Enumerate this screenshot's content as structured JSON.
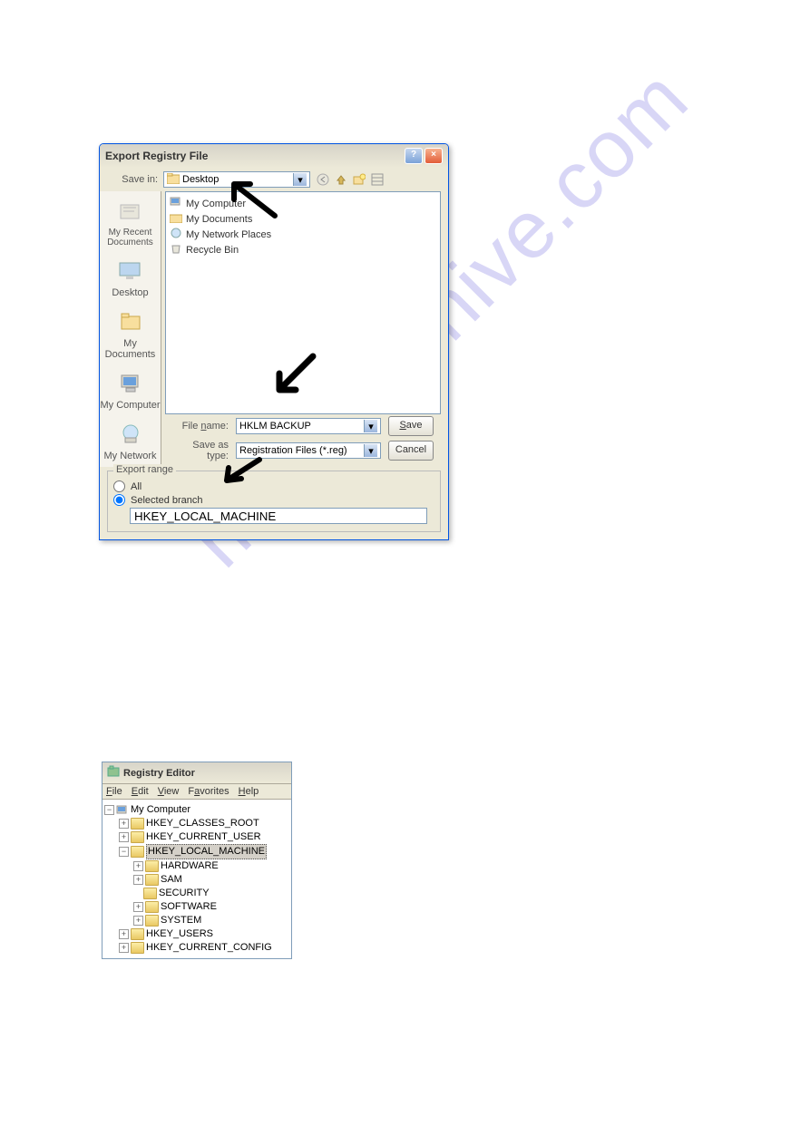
{
  "watermark": "manualshive.com",
  "export": {
    "title": "Export Registry File",
    "savein_label": "Save in:",
    "savein_value": "Desktop",
    "files": [
      "My Computer",
      "My Documents",
      "My Network Places",
      "Recycle Bin"
    ],
    "sidebar": [
      "My Recent Documents",
      "Desktop",
      "My Documents",
      "My Computer",
      "My Network"
    ],
    "filename_label": "File name:",
    "filename_value": "HKLM BACKUP",
    "saveas_label": "Save as type:",
    "saveas_value": "Registration Files (*.reg)",
    "save_btn": "Save",
    "cancel_btn": "Cancel",
    "range_title": "Export range",
    "range_all": "All",
    "range_selected": "Selected branch",
    "branch_value": "HKEY_LOCAL_MACHINE"
  },
  "regedit": {
    "title": "Registry Editor",
    "menu": [
      "File",
      "Edit",
      "View",
      "Favorites",
      "Help"
    ],
    "root": "My Computer",
    "keys": {
      "hkcr": "HKEY_CLASSES_ROOT",
      "hkcu": "HKEY_CURRENT_USER",
      "hklm": "HKEY_LOCAL_MACHINE",
      "hardware": "HARDWARE",
      "sam": "SAM",
      "security": "SECURITY",
      "software": "SOFTWARE",
      "system": "SYSTEM",
      "hku": "HKEY_USERS",
      "hkcc": "HKEY_CURRENT_CONFIG"
    }
  }
}
